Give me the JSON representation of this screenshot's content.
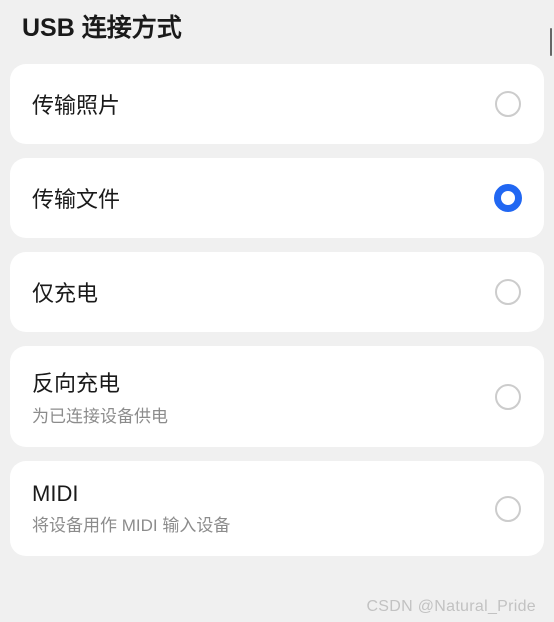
{
  "header": {
    "title": "USB 连接方式"
  },
  "options": [
    {
      "label": "传输照片",
      "subtitle": null,
      "selected": false
    },
    {
      "label": "传输文件",
      "subtitle": null,
      "selected": true
    },
    {
      "label": "仅充电",
      "subtitle": null,
      "selected": false
    },
    {
      "label": "反向充电",
      "subtitle": "为已连接设备供电",
      "selected": false
    },
    {
      "label": "MIDI",
      "subtitle": "将设备用作 MIDI 输入设备",
      "selected": false
    }
  ],
  "watermark": "CSDN @Natural_Pride",
  "colors": {
    "accent": "#2167f2",
    "background": "#f0f0f0",
    "card": "#ffffff",
    "text_primary": "#1a1a1a",
    "text_secondary": "#8c8c8c",
    "radio_border": "#cccccc"
  }
}
